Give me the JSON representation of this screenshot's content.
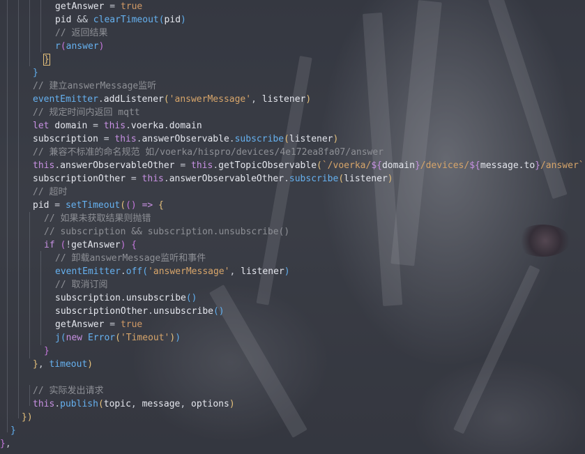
{
  "editor": {
    "lines": [
      "getAnswer = true",
      "pid && clearTimeout(pid)",
      "// 返回结果",
      "r(answer)",
      "}",
      "}",
      "// 建立answerMessage监听",
      "eventEmitter.addListener('answerMessage', listener)",
      "// 规定时间内返回 mqtt",
      "let domain = this.voerka.domain",
      "subscription = this.answerObservable.subscribe(listener)",
      "// 兼容不标准的命名规范 如/voerka/hispro/devices/4e172ea8fa07/answer",
      "this.answerObservableOther = this.getTopicObservable(`/voerka/${domain}/devices/${message.to}/answer`)",
      "subscriptionOther = this.answerObservableOther.subscribe(listener)",
      "// 超时",
      "pid = setTimeout(() => {",
      "// 如果未获取结果则抛错",
      "// subscription && subscription.unsubscribe()",
      "if (!getAnswer) {",
      "// 卸载answerMessage监听和事件",
      "eventEmitter.off('answerMessage', listener)",
      "// 取消订阅",
      "subscription.unsubscribe()",
      "subscriptionOther.unsubscribe()",
      "getAnswer = true",
      "j(new Error('Timeout'))",
      "}",
      "}, timeout)",
      "",
      "// 实际发出请求",
      "this.publish(topic, message, options)",
      "})",
      "}",
      "},"
    ]
  }
}
